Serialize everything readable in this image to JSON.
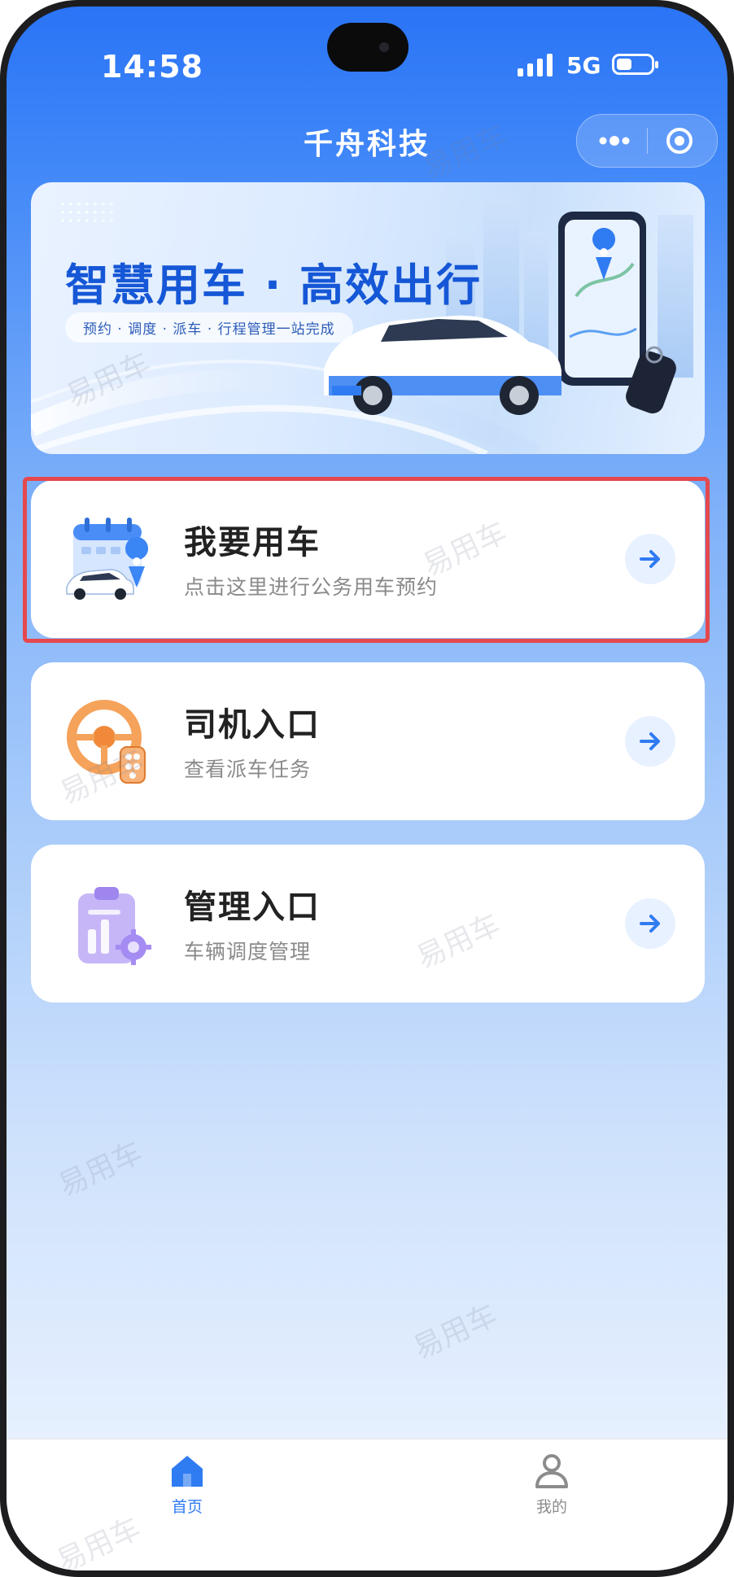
{
  "status_bar": {
    "time": "14:58",
    "network": "5G",
    "battery_level": 0.45
  },
  "nav": {
    "title": "千舟科技",
    "more_icon": "more-dots-icon",
    "close_icon": "target-close-icon"
  },
  "banner": {
    "title": "智慧用车 · 高效出行",
    "subtitle": "预约 · 调度 · 派车 · 行程管理一站完成"
  },
  "cards": [
    {
      "title": "我要用车",
      "subtitle": "点击这里进行公务用车预约",
      "icon": "calendar-car-icon",
      "highlighted": true
    },
    {
      "title": "司机入口",
      "subtitle": "查看派车任务",
      "icon": "steering-wheel-icon",
      "highlighted": false
    },
    {
      "title": "管理入口",
      "subtitle": "车辆调度管理",
      "icon": "management-chart-icon",
      "highlighted": false
    }
  ],
  "watermark_text": "易用车",
  "tabbar": {
    "items": [
      {
        "label": "首页",
        "icon": "home-icon",
        "active": true
      },
      {
        "label": "我的",
        "icon": "user-icon",
        "active": false
      }
    ]
  },
  "colors": {
    "brand": "#2a74f6",
    "accent_arrow": "#2f7bf2",
    "highlight_border": "#e5484d"
  }
}
